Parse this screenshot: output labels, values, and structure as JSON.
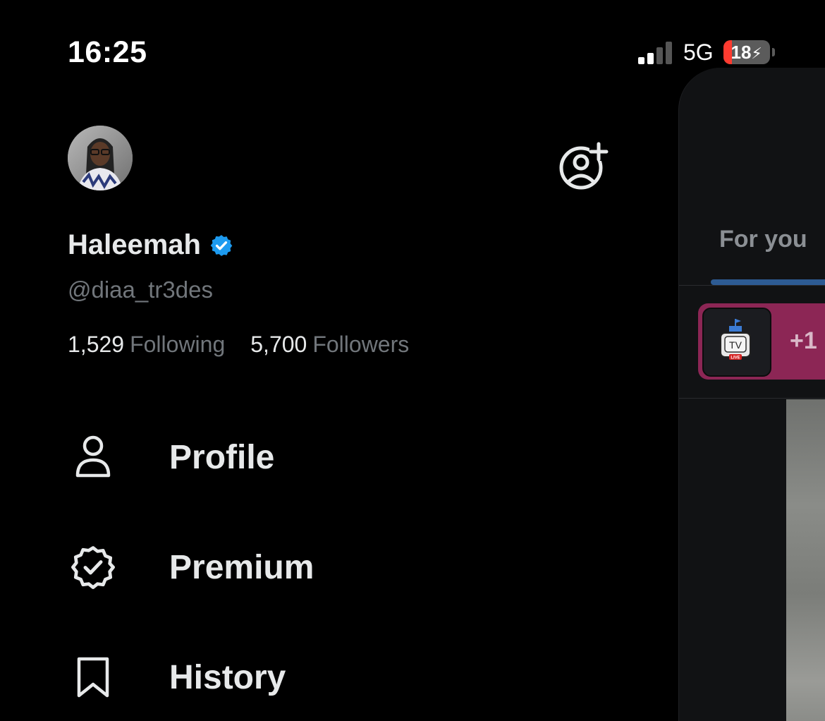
{
  "status_bar": {
    "time": "16:25",
    "network": "5G",
    "battery": "18",
    "battery_level": 0.18,
    "signal_bars": 2,
    "battery_color": "#ff3b30"
  },
  "drawer": {
    "add_account_icon": "add-person-icon",
    "user": {
      "display_name": "Haleemah",
      "verified": true,
      "verified_color": "#1d9bf0",
      "handle": "@diaa_tr3des"
    },
    "stats": {
      "following_count": "1,529",
      "following_label": "Following",
      "followers_count": "5,700",
      "followers_label": "Followers"
    },
    "menu": [
      {
        "label": "Profile",
        "icon": "person-icon"
      },
      {
        "label": "Premium",
        "icon": "verified-badge-icon"
      },
      {
        "label": "History",
        "icon": "bookmark-icon"
      }
    ]
  },
  "feed": {
    "tab_label": "For you",
    "spaces_extra": "+1",
    "space_thumb_text": "TV",
    "space_live_badge": "LIVE",
    "spaces_color": "#8c2655"
  }
}
